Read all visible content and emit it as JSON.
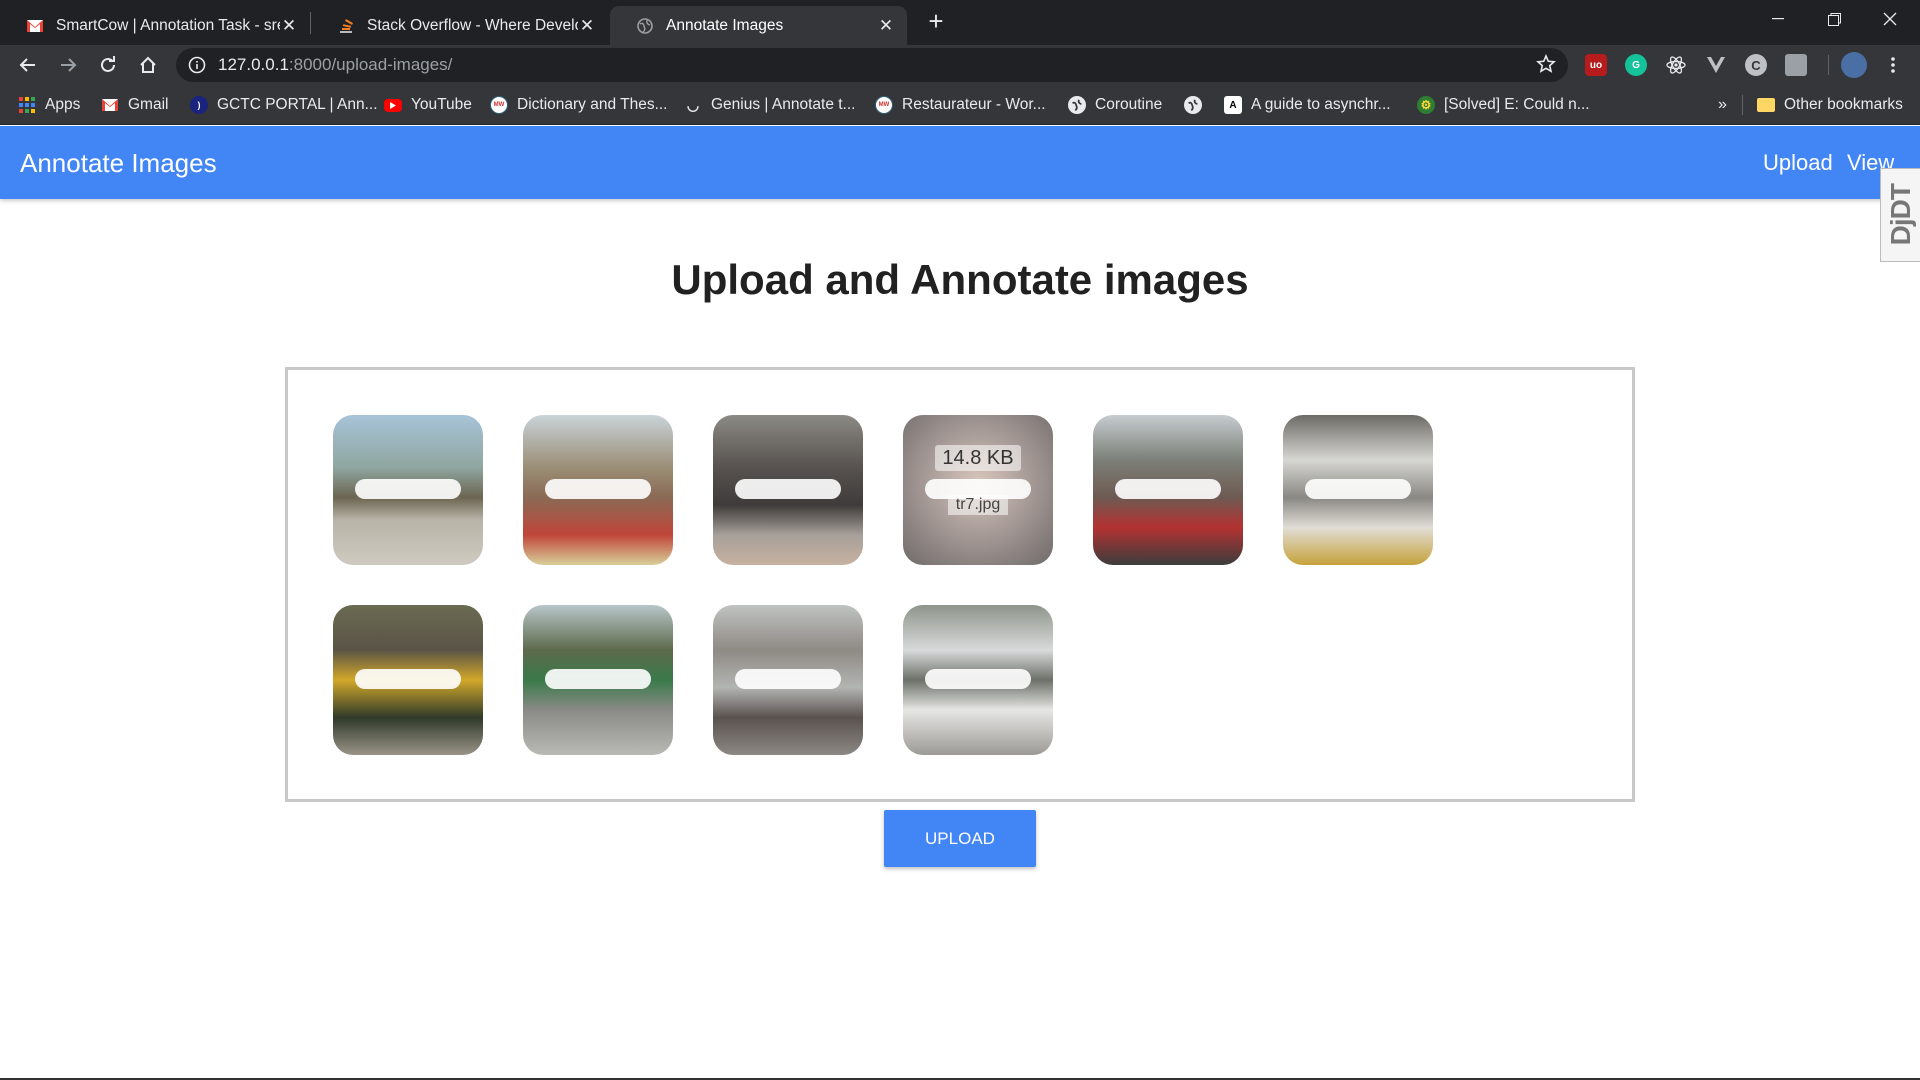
{
  "browser": {
    "tabs": [
      {
        "title": "SmartCow | Annotation Task - sre",
        "favicon": "gmail-icon"
      },
      {
        "title": "Stack Overflow - Where Develope",
        "favicon": "stackoverflow-icon"
      },
      {
        "title": "Annotate Images",
        "favicon": "globe-icon"
      }
    ],
    "url_host": "127.0.0.1",
    "url_rest": ":8000/upload-images/",
    "bookmarks": [
      {
        "label": "Apps",
        "icon": "apps-grid-icon"
      },
      {
        "label": "Gmail",
        "icon": "gmail-icon"
      },
      {
        "label": "GCTC PORTAL | Ann...",
        "icon": "gctc-icon"
      },
      {
        "label": "YouTube",
        "icon": "youtube-icon"
      },
      {
        "label": "Dictionary and Thes...",
        "icon": "merriam-webster-icon"
      },
      {
        "label": "Genius | Annotate t...",
        "icon": "genius-icon"
      },
      {
        "label": "Restaurateur - Wor...",
        "icon": "merriam-webster-icon"
      },
      {
        "label": "Coroutine",
        "icon": "globe-icon"
      },
      {
        "label": "",
        "icon": "globe-icon"
      },
      {
        "label": "A guide to asynchr...",
        "icon": "angular-icon"
      },
      {
        "label": "[Solved] E: Could n...",
        "icon": "gear-icon"
      }
    ],
    "overflow": "»",
    "other_bookmarks": "Other bookmarks"
  },
  "app": {
    "brand": "Annotate Images",
    "nav": {
      "upload": "Upload",
      "view": "View"
    },
    "ddt_badge": "DjDT",
    "heading": "Upload and Annotate images",
    "hover_thumb": {
      "size": "14.8 KB",
      "filename": "tr7.jpg"
    },
    "upload_button": "UPLOAD",
    "thumbnail_count": 10
  },
  "colors": {
    "primary": "#4285f4",
    "chrome_dark": "#202124",
    "chrome_toolbar": "#35363a"
  }
}
